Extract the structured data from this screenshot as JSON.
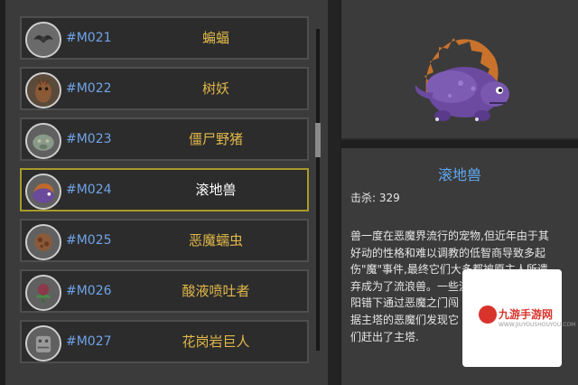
{
  "monster_list": [
    {
      "code": "#M021",
      "name": "蝙蝠",
      "icon": "bat-icon"
    },
    {
      "code": "#M022",
      "name": "树妖",
      "icon": "treant-icon"
    },
    {
      "code": "#M023",
      "name": "僵尸野猪",
      "icon": "zombie-boar-icon"
    },
    {
      "code": "#M024",
      "name": "滚地兽",
      "icon": "roller-beast-icon",
      "selected": true
    },
    {
      "code": "#M025",
      "name": "恶魔蠕虫",
      "icon": "demon-worm-icon"
    },
    {
      "code": "#M026",
      "name": "酸液喷吐者",
      "icon": "acid-spitter-icon"
    },
    {
      "code": "#M027",
      "name": "花岗岩巨人",
      "icon": "granite-giant-icon"
    }
  ],
  "detail": {
    "title": "滚地兽",
    "kills_label": "击杀:",
    "kills_value": "329",
    "portrait_icon": "roller-beast-portrait",
    "description_lines": [
      "兽一度在恶魔界流行的宠物,但近年由于其",
      "好动的性格和难以调教的低智商导致多起",
      "伤\"魔\"事件,最终它们大多都被原主人所遗",
      "弃成为了流浪兽。一些流",
      "阳错下通过恶魔之门闯",
      "据主塔的恶魔们发现它",
      "们赶出了主塔."
    ]
  },
  "watermark": {
    "text": "九游手游网",
    "url": "WWW.JIUYOUSHOUYOU.COM"
  },
  "colors": {
    "code_blue": "#6fa3e8",
    "name_gold": "#e1b74a",
    "title_blue": "#5fa8f0",
    "selected_border": "#a89a2c"
  }
}
